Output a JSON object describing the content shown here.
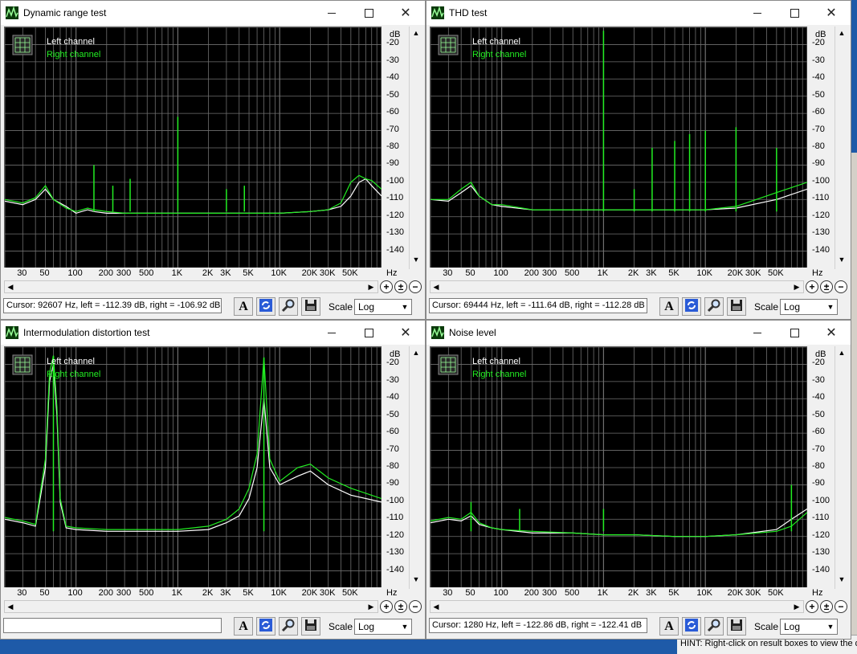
{
  "axis": {
    "db_unit": "dB",
    "hz_unit": "Hz",
    "db_ticks": [
      "-20",
      "-30",
      "-40",
      "-50",
      "-60",
      "-70",
      "-80",
      "-90",
      "-100",
      "-110",
      "-120",
      "-130",
      "-140"
    ],
    "hz_ticks": [
      {
        "label": "30",
        "hz": 30
      },
      {
        "label": "50",
        "hz": 50
      },
      {
        "label": "100",
        "hz": 100
      },
      {
        "label": "200",
        "hz": 200
      },
      {
        "label": "300",
        "hz": 300
      },
      {
        "label": "500",
        "hz": 500
      },
      {
        "label": "1K",
        "hz": 1000
      },
      {
        "label": "2K",
        "hz": 2000
      },
      {
        "label": "3K",
        "hz": 3000
      },
      {
        "label": "5K",
        "hz": 5000
      },
      {
        "label": "10K",
        "hz": 10000
      },
      {
        "label": "20K",
        "hz": 20000
      },
      {
        "label": "30K",
        "hz": 30000
      },
      {
        "label": "50K",
        "hz": 50000
      }
    ]
  },
  "legend": {
    "left": "Left channel",
    "right": "Right channel"
  },
  "colors": {
    "left": "#ffffff",
    "right": "#22ee22",
    "grid": "#6f6f6f",
    "plot_bg": "#000000"
  },
  "hint": "HINT: Right-click on result boxes to view the d",
  "windows": [
    {
      "title": "Dynamic range test",
      "cursor": "Cursor:  92607 Hz,  left = -112.39 dB,  right = -106.92 dB",
      "scale": "Log",
      "scale_options": [
        "Log"
      ]
    },
    {
      "title": "THD test",
      "cursor": "Cursor:  69444 Hz,  left = -111.64 dB,  right = -112.28 dB",
      "scale": "Log",
      "scale_options": [
        "Log"
      ]
    },
    {
      "title": "Intermodulation distortion test",
      "cursor": "",
      "scale": "Log",
      "scale_options": [
        "Log"
      ]
    },
    {
      "title": "Noise level",
      "cursor": "Cursor:  1280 Hz,  left = -122.86 dB,  right = -122.41 dB",
      "scale": "Log",
      "scale_options": [
        "Log"
      ]
    }
  ],
  "chart_data": [
    {
      "type": "line",
      "title": "Dynamic range test",
      "xlabel": "Hz",
      "ylabel": "dB",
      "xlim": [
        20,
        100000
      ],
      "ylim": [
        -150,
        -10
      ],
      "x_scale": "log",
      "grid": true,
      "legend": "top-left",
      "series": [
        {
          "name": "Left channel",
          "x": [
            20,
            30,
            40,
            50,
            60,
            80,
            100,
            130,
            150,
            200,
            300,
            500,
            1000,
            2000,
            5000,
            10000,
            20000,
            30000,
            40000,
            50000,
            60000,
            70000,
            80000,
            100000
          ],
          "y": [
            -111,
            -113,
            -110,
            -104,
            -110,
            -114,
            -118,
            -116,
            -117,
            -118,
            -118,
            -118,
            -118,
            -118,
            -118,
            -118,
            -117,
            -116,
            -114,
            -108,
            -100,
            -98,
            -102,
            -108
          ]
        },
        {
          "name": "Right channel",
          "x": [
            20,
            30,
            40,
            50,
            60,
            80,
            100,
            130,
            150,
            200,
            300,
            500,
            1000,
            2000,
            5000,
            10000,
            20000,
            30000,
            40000,
            50000,
            60000,
            70000,
            80000,
            100000
          ],
          "y": [
            -110,
            -112,
            -109,
            -102,
            -110,
            -115,
            -117,
            -115,
            -116,
            -117,
            -118,
            -118,
            -118,
            -118,
            -118,
            -118,
            -117,
            -116,
            -112,
            -100,
            -96,
            -98,
            -99,
            -104
          ]
        }
      ],
      "peaks": [
        {
          "hz": 150,
          "db": -90
        },
        {
          "hz": 230,
          "db": -102
        },
        {
          "hz": 340,
          "db": -98
        },
        {
          "hz": 1000,
          "db": -62
        },
        {
          "hz": 3000,
          "db": -104
        },
        {
          "hz": 4500,
          "db": -102
        }
      ]
    },
    {
      "type": "line",
      "title": "THD test",
      "xlabel": "Hz",
      "ylabel": "dB",
      "xlim": [
        20,
        100000
      ],
      "ylim": [
        -150,
        -10
      ],
      "x_scale": "log",
      "grid": true,
      "legend": "top-left",
      "series": [
        {
          "name": "Left channel",
          "x": [
            20,
            30,
            40,
            50,
            60,
            80,
            100,
            200,
            500,
            1000,
            2000,
            5000,
            10000,
            20000,
            50000,
            100000
          ],
          "y": [
            -110,
            -111,
            -106,
            -102,
            -108,
            -113,
            -114,
            -116,
            -116,
            -116,
            -116,
            -116,
            -116,
            -115,
            -110,
            -104
          ]
        },
        {
          "name": "Right channel",
          "x": [
            20,
            30,
            40,
            50,
            60,
            80,
            100,
            200,
            500,
            1000,
            2000,
            5000,
            10000,
            20000,
            50000,
            100000
          ],
          "y": [
            -110,
            -110,
            -104,
            -100,
            -108,
            -113,
            -113,
            -116,
            -116,
            -116,
            -116,
            -116,
            -116,
            -114,
            -106,
            -100
          ]
        }
      ],
      "peaks": [
        {
          "hz": 1000,
          "db": -12
        },
        {
          "hz": 2000,
          "db": -104
        },
        {
          "hz": 3000,
          "db": -80
        },
        {
          "hz": 5000,
          "db": -76
        },
        {
          "hz": 7000,
          "db": -72
        },
        {
          "hz": 10000,
          "db": -70
        },
        {
          "hz": 20000,
          "db": -68
        },
        {
          "hz": 50000,
          "db": -80
        }
      ]
    },
    {
      "type": "line",
      "title": "Intermodulation distortion test",
      "xlabel": "Hz",
      "ylabel": "dB",
      "xlim": [
        20,
        100000
      ],
      "ylim": [
        -150,
        -10
      ],
      "x_scale": "log",
      "grid": true,
      "legend": "top-left",
      "series": [
        {
          "name": "Left channel",
          "x": [
            20,
            30,
            40,
            50,
            55,
            60,
            65,
            70,
            80,
            100,
            200,
            500,
            1000,
            2000,
            3000,
            4000,
            5000,
            6000,
            7000,
            8000,
            10000,
            15000,
            20000,
            30000,
            50000,
            100000
          ],
          "y": [
            -110,
            -112,
            -114,
            -80,
            -30,
            -20,
            -50,
            -100,
            -115,
            -116,
            -117,
            -117,
            -117,
            -116,
            -112,
            -108,
            -98,
            -80,
            -40,
            -80,
            -90,
            -85,
            -82,
            -90,
            -96,
            -100
          ]
        },
        {
          "name": "Right channel",
          "x": [
            20,
            30,
            40,
            50,
            55,
            60,
            65,
            70,
            80,
            100,
            200,
            500,
            1000,
            2000,
            3000,
            4000,
            5000,
            6000,
            7000,
            8000,
            10000,
            15000,
            20000,
            30000,
            50000,
            100000
          ],
          "y": [
            -109,
            -111,
            -113,
            -75,
            -25,
            -15,
            -45,
            -98,
            -114,
            -115,
            -116,
            -116,
            -116,
            -114,
            -110,
            -104,
            -92,
            -72,
            -16,
            -75,
            -88,
            -80,
            -78,
            -86,
            -92,
            -98
          ]
        }
      ],
      "peaks": [
        {
          "hz": 60,
          "db": -15
        },
        {
          "hz": 7000,
          "db": -16
        }
      ]
    },
    {
      "type": "line",
      "title": "Noise level",
      "xlabel": "Hz",
      "ylabel": "dB",
      "xlim": [
        20,
        100000
      ],
      "ylim": [
        -150,
        -10
      ],
      "x_scale": "log",
      "grid": true,
      "legend": "top-left",
      "series": [
        {
          "name": "Left channel",
          "x": [
            20,
            30,
            40,
            50,
            60,
            80,
            100,
            200,
            500,
            1000,
            2000,
            5000,
            10000,
            20000,
            50000,
            70000,
            100000
          ],
          "y": [
            -112,
            -110,
            -111,
            -108,
            -113,
            -115,
            -116,
            -118,
            -118,
            -119,
            -119,
            -120,
            -120,
            -119,
            -116,
            -110,
            -104
          ]
        },
        {
          "name": "Right channel",
          "x": [
            20,
            30,
            40,
            50,
            60,
            80,
            100,
            200,
            500,
            1000,
            2000,
            5000,
            10000,
            20000,
            50000,
            70000,
            100000
          ],
          "y": [
            -111,
            -109,
            -110,
            -106,
            -112,
            -115,
            -116,
            -117,
            -118,
            -119,
            -119,
            -120,
            -120,
            -119,
            -117,
            -114,
            -106
          ]
        }
      ],
      "peaks": [
        {
          "hz": 50,
          "db": -100
        },
        {
          "hz": 150,
          "db": -104
        },
        {
          "hz": 1000,
          "db": -104
        },
        {
          "hz": 70000,
          "db": -90
        }
      ]
    }
  ]
}
